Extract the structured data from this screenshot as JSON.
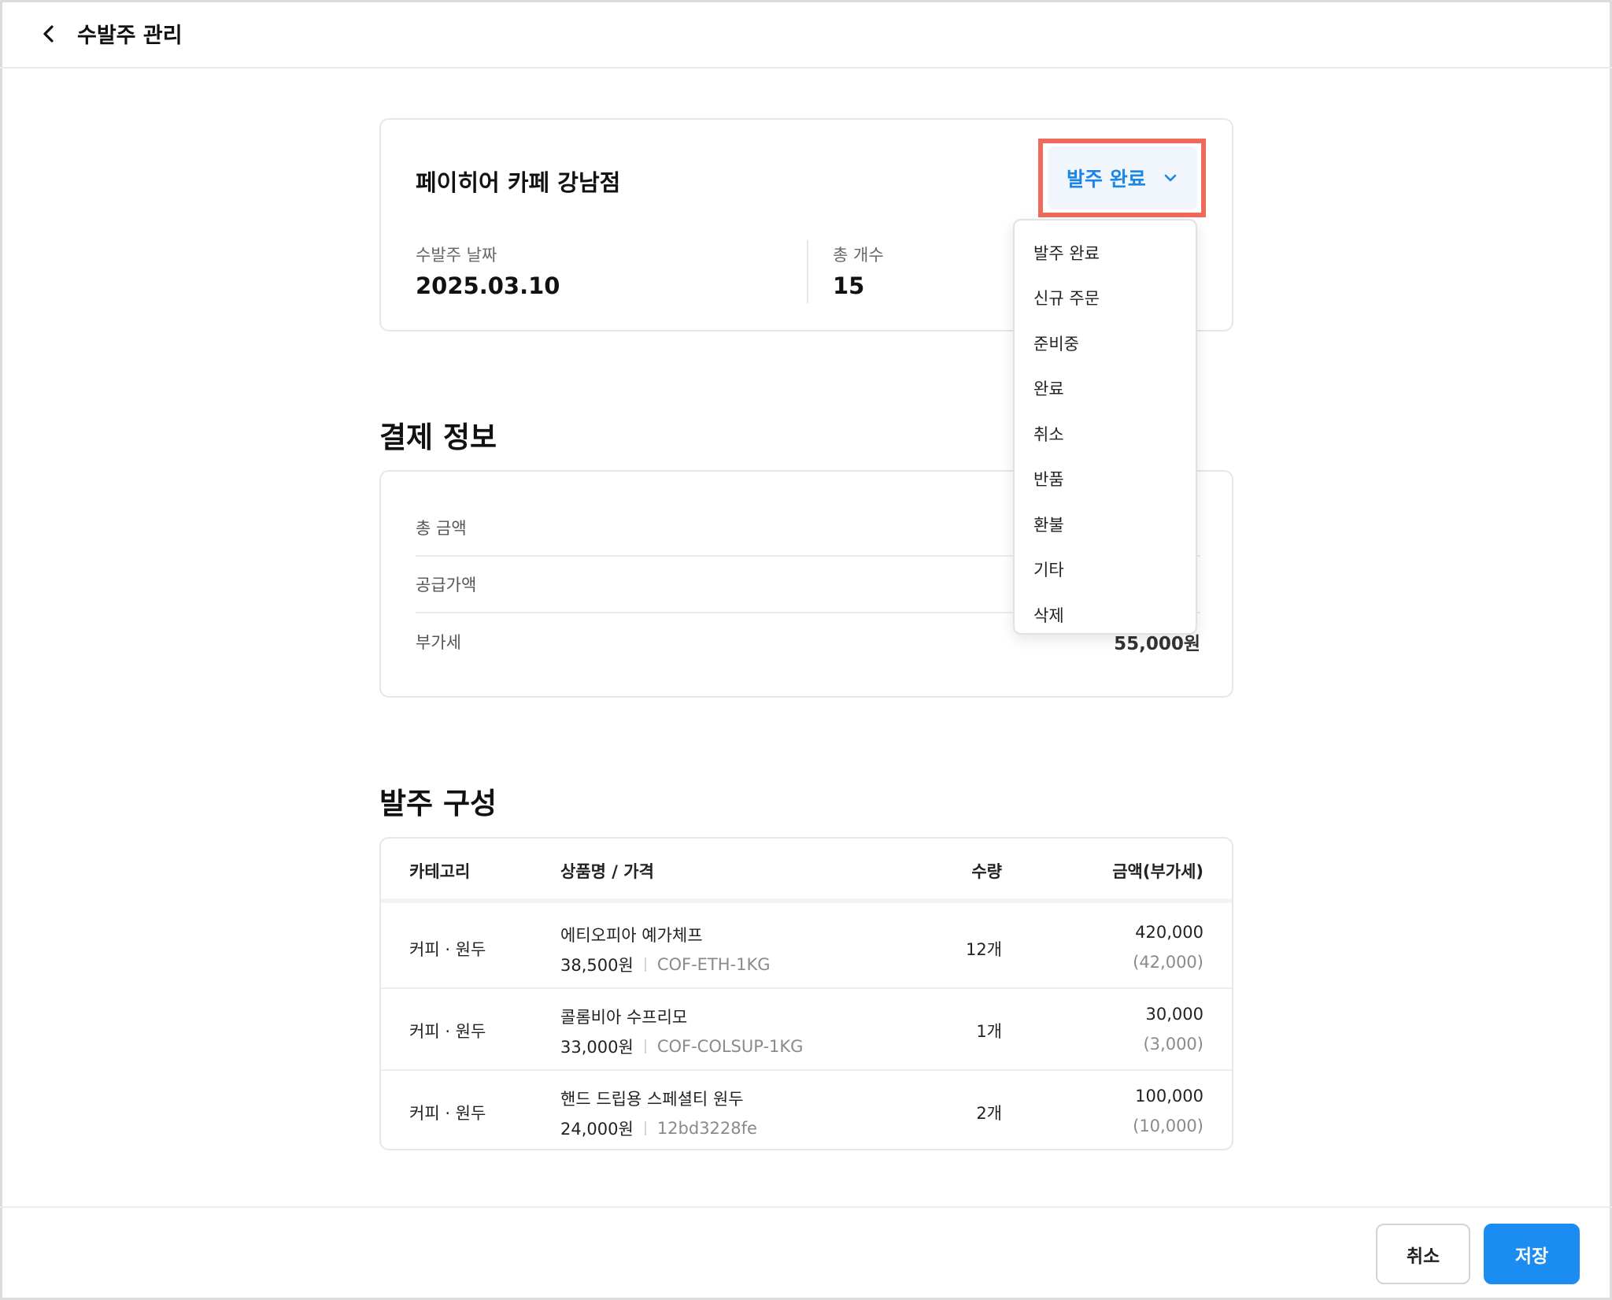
{
  "header": {
    "title": "수발주 관리",
    "back_icon": "chevron-left-icon"
  },
  "store": {
    "name": "페이히어 카페 강남점",
    "date_label": "수발주 날짜",
    "date_value": "2025.03.10",
    "count_label": "총 개수",
    "count_value": "15"
  },
  "status": {
    "selected": "발주 완료",
    "accent": "#1a86e8",
    "highlight_color": "#ef6a5a",
    "options": [
      "발주 완료",
      "신규 주문",
      "준비중",
      "완료",
      "취소",
      "반품",
      "환불",
      "기타",
      "삭제"
    ]
  },
  "payment": {
    "title": "결제 정보",
    "rows": [
      {
        "label": "총 금액",
        "value": ""
      },
      {
        "label": "공급가액",
        "value": ""
      },
      {
        "label": "부가세",
        "value": "55,000원"
      }
    ]
  },
  "orders": {
    "title": "발주 구성",
    "columns": [
      "카테고리",
      "상품명 / 가격",
      "수량",
      "금액(부가세)"
    ],
    "rows": [
      {
        "category": "커피 · 원두",
        "name": "에티오피아 예가체프",
        "price": "38,500원",
        "code": "COF-ETH-1KG",
        "qty": "12개",
        "amount": "420,000",
        "vat": "(42,000)"
      },
      {
        "category": "커피 · 원두",
        "name": "콜롬비아 수프리모",
        "price": "33,000원",
        "code": "COF-COLSUP-1KG",
        "qty": "1개",
        "amount": "30,000",
        "vat": "(3,000)"
      },
      {
        "category": "커피 · 원두",
        "name": "핸드 드립용 스페셜티 원두",
        "price": "24,000원",
        "code": "12bd3228fe",
        "qty": "2개",
        "amount": "100,000",
        "vat": "(10,000)"
      }
    ]
  },
  "footer": {
    "cancel_label": "취소",
    "save_label": "저장",
    "save_color": "#1a8cf2"
  }
}
